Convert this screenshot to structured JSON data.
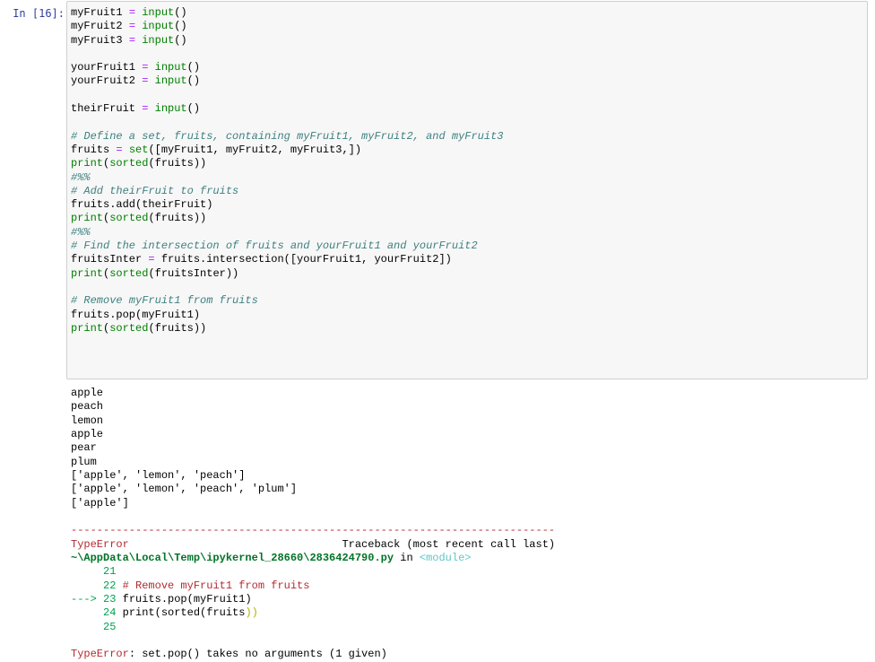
{
  "prompt": "In [16]:",
  "code_lines": [
    "myFruit1 = input()",
    "myFruit2 = input()",
    "myFruit3 = input()",
    "",
    "yourFruit1 = input()",
    "yourFruit2 = input()",
    "",
    "theirFruit = input()",
    "",
    "# Define a set, fruits, containing myFruit1, myFruit2, and myFruit3",
    "fruits = set([myFruit1, myFruit2, myFruit3,])",
    "print(sorted(fruits))",
    "#%%",
    "# Add theirFruit to fruits",
    "fruits.add(theirFruit)",
    "print(sorted(fruits))",
    "#%%",
    "# Find the intersection of fruits and yourFruit1 and yourFruit2",
    "fruitsInter = fruits.intersection([yourFruit1, yourFruit2])",
    "print(sorted(fruitsInter))",
    "",
    "# Remove myFruit1 from fruits",
    "fruits.pop(myFruit1)",
    "print(sorted(fruits))"
  ],
  "stdout_lines": [
    "apple",
    "peach",
    "lemon",
    "apple",
    "pear",
    "plum",
    "['apple', 'lemon', 'peach']",
    "['apple', 'lemon', 'peach', 'plum']",
    "['apple']"
  ],
  "traceback": {
    "dashes": "---------------------------------------------------------------------------",
    "error_name": "TypeError",
    "traceback_label": "Traceback (most recent call last)",
    "file_path": "~\\AppData\\Local\\Temp\\ipykernel_28660\\2836424790.py",
    "in_word": " in ",
    "module": "<module>",
    "line21_num": "21",
    "line22_num": "22",
    "line22_code": "# Remove myFruit1 from fruits",
    "arrow": "--->",
    "line23_num": "23",
    "line23_code": "fruits.pop(myFruit1)",
    "line24_num": "24",
    "line24_code_a": "print(sorted(fruits",
    "line24_code_b": "))",
    "line25_num": "25",
    "final_error_name": "TypeError",
    "final_error_msg": ": set.pop() takes no arguments (1 given)"
  }
}
